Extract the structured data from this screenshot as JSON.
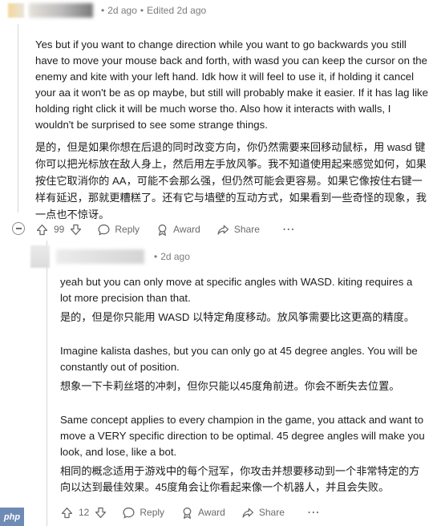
{
  "comment1": {
    "timestamp": "2d ago",
    "edited": "Edited 2d ago",
    "separator": "•",
    "body_en": "Yes but if you want to change direction while you want to go backwards you still have to move your mouse back and forth, with wasd you can keep the cursor on the enemy and kite with your left hand. Idk how it will feel to use it, if holding it cancel your aa it won't be as op maybe, but still will probably make it easier. If it has lag like holding right click it will be much worse tho. Also how it interacts with walls, I wouldn't be surprised to see some strange things.",
    "body_zh": "是的，但是如果你想在后退的同时改变方向，你仍然需要来回移动鼠标，用 wasd 键你可以把光标放在敌人身上，然后用左手放风筝。我不知道使用起来感觉如何，如果按住它取消你的 AA，可能不会那么强，但仍然可能会更容易。如果它像按住右键一样有延迟，那就更糟糕了。还有它与墙壁的互动方式，如果看到一些奇怪的现象，我一点也不惊讶。",
    "actions": {
      "votes": "99",
      "reply": "Reply",
      "award": "Award",
      "share": "Share",
      "more": "⋯"
    }
  },
  "comment2": {
    "timestamp": "2d ago",
    "separator": "•",
    "paragraphs": [
      {
        "en": "yeah but you can only move at specific angles with WASD. kiting requires a lot more precision than that.",
        "zh": "是的，但是你只能用 WASD 以特定角度移动。放风筝需要比这更高的精度。"
      },
      {
        "en": "Imagine kalista dashes, but you can only go at 45 degree angles. You will be constantly out of position.",
        "zh": "想象一下卡莉丝塔的冲刺，但你只能以45度角前进。你会不断失去位置。"
      },
      {
        "en": "Same concept applies to every champion in the game, you attack and want to move a VERY specific direction to be optimal. 45 degree angles will make you look, and lose, like a bot.",
        "zh": "相同的概念适用于游戏中的每个冠军，你攻击并想要移动到一个非常特定的方向以达到最佳效果。45度角会让你看起来像一个机器人，并且会失败。"
      }
    ],
    "actions": {
      "votes": "12",
      "reply": "Reply",
      "award": "Award",
      "share": "Share",
      "more": "⋯"
    }
  },
  "watermark": "php",
  "colors": {
    "text": "#1c1c1c",
    "meta": "#7c7c7c",
    "line": "#d4d7d9"
  }
}
